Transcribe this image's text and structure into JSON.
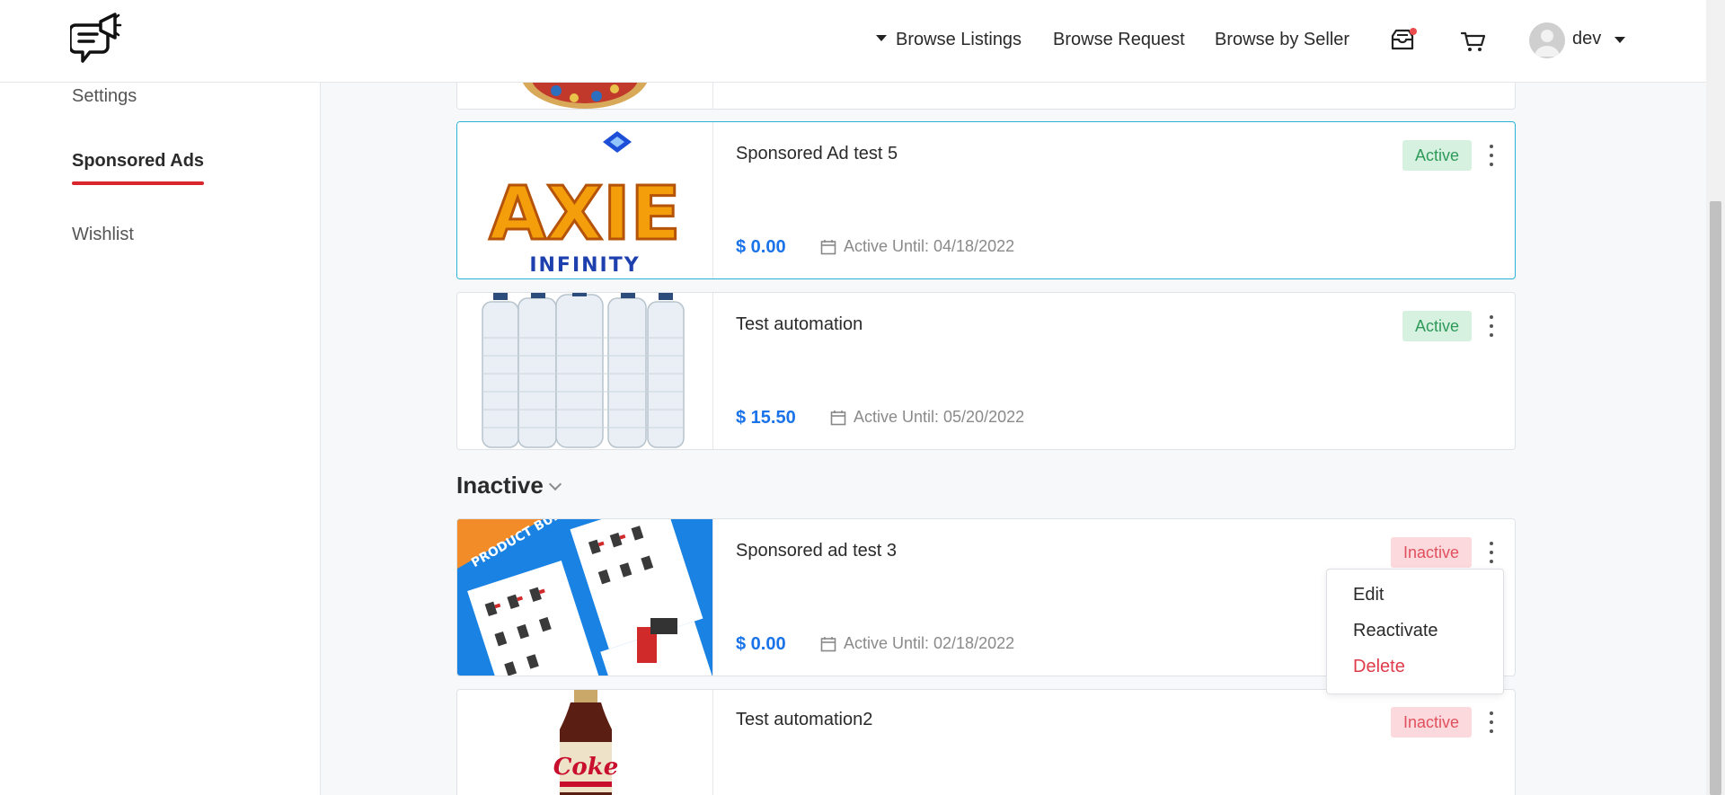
{
  "header": {
    "nav": {
      "browse_listings": "Browse Listings",
      "browse_request": "Browse Request",
      "browse_by_seller": "Browse by Seller"
    },
    "icons": [
      "megaphone-chat-logo",
      "inbox-icon",
      "cart-icon",
      "avatar"
    ],
    "user": {
      "name": "dev"
    },
    "notification_dot_color": "#e84c4c"
  },
  "sidebar": {
    "items": [
      {
        "label": "Settings",
        "active": false
      },
      {
        "label": "Sponsored Ads",
        "active": true
      },
      {
        "label": "Wishlist",
        "active": false
      }
    ],
    "active_underline_color": "#d8262c"
  },
  "ads": {
    "active": [
      {
        "title": "Sponsored Ad test 5",
        "price": "$ 0.00",
        "date": "Active Until: 04/18/2022",
        "status": "Active",
        "image": "axie-infinity-logo",
        "thumb_text": "INFINITY"
      },
      {
        "title": "Test automation",
        "price": "$ 15.50",
        "date": "Active Until: 05/20/2022",
        "status": "Active",
        "image": "water-bottles"
      }
    ],
    "inactive_heading": "Inactive",
    "inactive": [
      {
        "title": "Sponsored ad test 3",
        "price": "$ 0.00",
        "date": "Active Until: 02/18/2022",
        "status": "Inactive",
        "image": "product-bundle",
        "thumb_text": "PRODUCT BUNDLE"
      },
      {
        "title": "Test automation2",
        "status": "Inactive",
        "image": "coke-bottle",
        "thumb_text": "Coke"
      }
    ]
  },
  "context_menu": {
    "items": [
      "Edit",
      "Reactivate",
      "Delete"
    ]
  },
  "colors": {
    "price": "#1a73e8",
    "active_badge_bg": "#d6f1e0",
    "active_badge_text": "#2e9a59",
    "inactive_badge_bg": "#fbd9dc",
    "inactive_badge_text": "#e0505e",
    "selected_border": "#2bb3d6",
    "delete": "#e03b4a"
  }
}
